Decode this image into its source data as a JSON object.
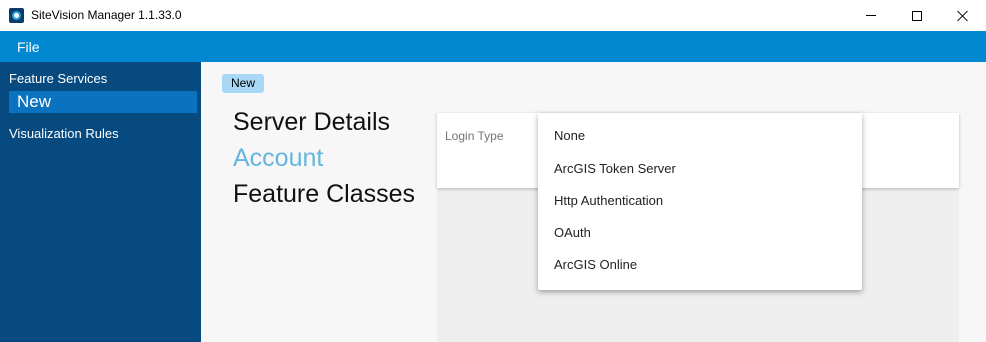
{
  "window": {
    "title": "SiteVision Manager 1.1.33.0",
    "icon": "sitevision-app-icon"
  },
  "menu": {
    "file_label": "File"
  },
  "sidebar": {
    "feature_services": "Feature Services",
    "new": "New",
    "visualization_rules": "Visualization Rules"
  },
  "content": {
    "chip": "New",
    "steps": {
      "server_details": "Server Details",
      "account": "Account",
      "feature_classes": "Feature Classes"
    },
    "login_type_label": "Login Type",
    "login_options": [
      "None",
      "ArcGIS Token Server",
      "Http Authentication",
      "OAuth",
      "ArcGIS Online"
    ]
  },
  "colors": {
    "menu_bar": "#0288d1",
    "sidebar": "#064a7f",
    "sidebar_selected": "#0b72bf",
    "active_step": "#66b5e0",
    "chip": "#a8d8f5"
  }
}
